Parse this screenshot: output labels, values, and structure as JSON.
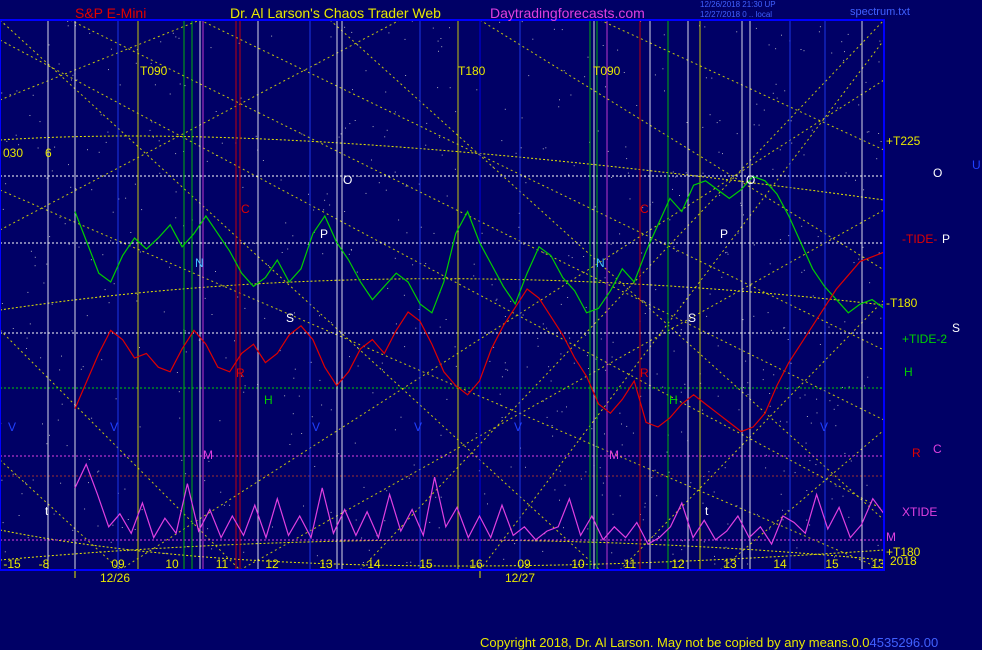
{
  "header": {
    "left": "S&P E-Mini",
    "center": "Dr. Al Larson's Chaos Trader Web",
    "right": "Daytradingforecasts.com",
    "stamp1": "12/26/2018 21:30 UP",
    "stamp2": "12/27/2018 0 .. local",
    "right_label": "spectrum.txt"
  },
  "footer": {
    "copyright": "Copyright 2018, Dr. Al Larson. May not be copied by any means.",
    "readout_prefix": "0.0",
    "readout_value": "4535296.00"
  },
  "colors": {
    "background": "#000066",
    "border": "#0000ff",
    "yellow": "#e8e800",
    "green": "#00d000",
    "red": "#e00000",
    "magenta": "#e040e0",
    "white": "#ffffff",
    "cyan": "#40c0ff"
  },
  "chart_data": {
    "type": "line",
    "title": "S&P E-Mini",
    "days": [
      "12/26",
      "12/27"
    ],
    "x_ticks": [
      "09",
      "10",
      "11",
      "12",
      "13",
      "14",
      "15",
      "16",
      "09",
      "10",
      "11",
      "12",
      "13",
      "14",
      "15",
      "13"
    ],
    "left_ticks": [
      "-15",
      "-8"
    ],
    "left_labels": [
      "030",
      "6"
    ],
    "turn_labels": [
      "T090",
      "T180",
      "T090"
    ],
    "right_labels": [
      {
        "text": "+T225",
        "color": "yellow"
      },
      {
        "text": "O",
        "color": "white"
      },
      {
        "text": "U",
        "color": "blue"
      },
      {
        "text": "-TIDE-",
        "color": "red"
      },
      {
        "text": "P",
        "color": "white"
      },
      {
        "text": "-T180",
        "color": "yellow"
      },
      {
        "text": "+TIDE-2",
        "color": "green"
      },
      {
        "text": "S",
        "color": "white"
      },
      {
        "text": "H",
        "color": "green"
      },
      {
        "text": "R",
        "color": "red"
      },
      {
        "text": "C",
        "color": "magenta"
      },
      {
        "text": "XTIDE",
        "color": "magenta"
      },
      {
        "text": "M",
        "color": "magenta"
      },
      {
        "text": "+T180",
        "color": "yellow"
      },
      {
        "text": "2018",
        "color": "yellow"
      }
    ],
    "planet_labels": [
      {
        "text": "C",
        "color": "red"
      },
      {
        "text": "O",
        "color": "white"
      },
      {
        "text": "P",
        "color": "white"
      },
      {
        "text": "N",
        "color": "cyan"
      },
      {
        "text": "S",
        "color": "white"
      },
      {
        "text": "R",
        "color": "red"
      },
      {
        "text": "H",
        "color": "green"
      },
      {
        "text": "M",
        "color": "magenta"
      },
      {
        "text": "V",
        "color": "blue"
      },
      {
        "text": "V",
        "color": "blue"
      },
      {
        "text": "V",
        "color": "blue"
      },
      {
        "text": "V",
        "color": "blue"
      },
      {
        "text": "V",
        "color": "blue"
      },
      {
        "text": "V",
        "color": "blue"
      },
      {
        "text": "t",
        "color": "white"
      },
      {
        "text": "t",
        "color": "white"
      },
      {
        "text": "N",
        "color": "cyan"
      },
      {
        "text": "S",
        "color": "white"
      },
      {
        "text": "P",
        "color": "white"
      },
      {
        "text": "O",
        "color": "white"
      },
      {
        "text": "C",
        "color": "red"
      },
      {
        "text": "R",
        "color": "red"
      },
      {
        "text": "H",
        "color": "green"
      },
      {
        "text": "M",
        "color": "magenta"
      }
    ],
    "series": [
      {
        "name": "+TIDE-2",
        "color": "green",
        "values": [
          0.72,
          0.58,
          0.44,
          0.4,
          0.52,
          0.6,
          0.55,
          0.6,
          0.66,
          0.56,
          0.62,
          0.7,
          0.62,
          0.54,
          0.44,
          0.38,
          0.42,
          0.5,
          0.4,
          0.46,
          0.62,
          0.7,
          0.58,
          0.5,
          0.4,
          0.32,
          0.38,
          0.44,
          0.4,
          0.3,
          0.26,
          0.4,
          0.62,
          0.72,
          0.58,
          0.48,
          0.38,
          0.3,
          0.44,
          0.56,
          0.52,
          0.42,
          0.36,
          0.26,
          0.28,
          0.36,
          0.46,
          0.4,
          0.54,
          0.66,
          0.78,
          0.72,
          0.84,
          0.86,
          0.82,
          0.78,
          0.82,
          0.88,
          0.86,
          0.8,
          0.7,
          0.58,
          0.46,
          0.38,
          0.32,
          0.26,
          0.3,
          0.32,
          0.28
        ]
      },
      {
        "name": "-TIDE-",
        "color": "red",
        "values": [
          0.18,
          0.3,
          0.42,
          0.52,
          0.48,
          0.4,
          0.42,
          0.36,
          0.34,
          0.44,
          0.52,
          0.46,
          0.36,
          0.34,
          0.42,
          0.46,
          0.38,
          0.42,
          0.5,
          0.54,
          0.48,
          0.36,
          0.28,
          0.34,
          0.44,
          0.48,
          0.42,
          0.52,
          0.6,
          0.56,
          0.46,
          0.34,
          0.28,
          0.24,
          0.3,
          0.44,
          0.54,
          0.62,
          0.7,
          0.66,
          0.58,
          0.5,
          0.4,
          0.32,
          0.2,
          0.16,
          0.22,
          0.3,
          0.12,
          0.1,
          0.14,
          0.2,
          0.24,
          0.2,
          0.16,
          0.12,
          0.08,
          0.1,
          0.16,
          0.28,
          0.38,
          0.46,
          0.54,
          0.62,
          0.7,
          0.76,
          0.82,
          0.84,
          0.86
        ]
      },
      {
        "name": "XTIDE",
        "color": "magenta",
        "values": [
          0.76,
          0.98,
          0.7,
          0.4,
          0.52,
          0.34,
          0.62,
          0.3,
          0.48,
          0.34,
          0.8,
          0.36,
          0.56,
          0.3,
          0.5,
          0.32,
          0.6,
          0.3,
          0.66,
          0.32,
          0.5,
          0.3,
          0.76,
          0.34,
          0.56,
          0.32,
          0.54,
          0.3,
          0.7,
          0.36,
          0.56,
          0.32,
          0.86,
          0.4,
          0.58,
          0.3,
          0.5,
          0.3,
          0.6,
          0.32,
          0.4,
          0.28,
          0.36,
          0.4,
          0.66,
          0.32,
          0.5,
          0.28,
          0.4,
          0.3,
          0.44,
          0.24,
          0.3,
          0.4,
          0.62,
          0.3,
          0.46,
          0.28,
          0.36,
          0.5,
          0.3,
          0.4,
          0.24,
          0.5,
          0.44,
          0.34,
          0.7,
          0.38,
          0.58,
          0.3,
          0.42,
          0.66,
          0.52
        ]
      }
    ],
    "grid": true,
    "legend": "none"
  }
}
